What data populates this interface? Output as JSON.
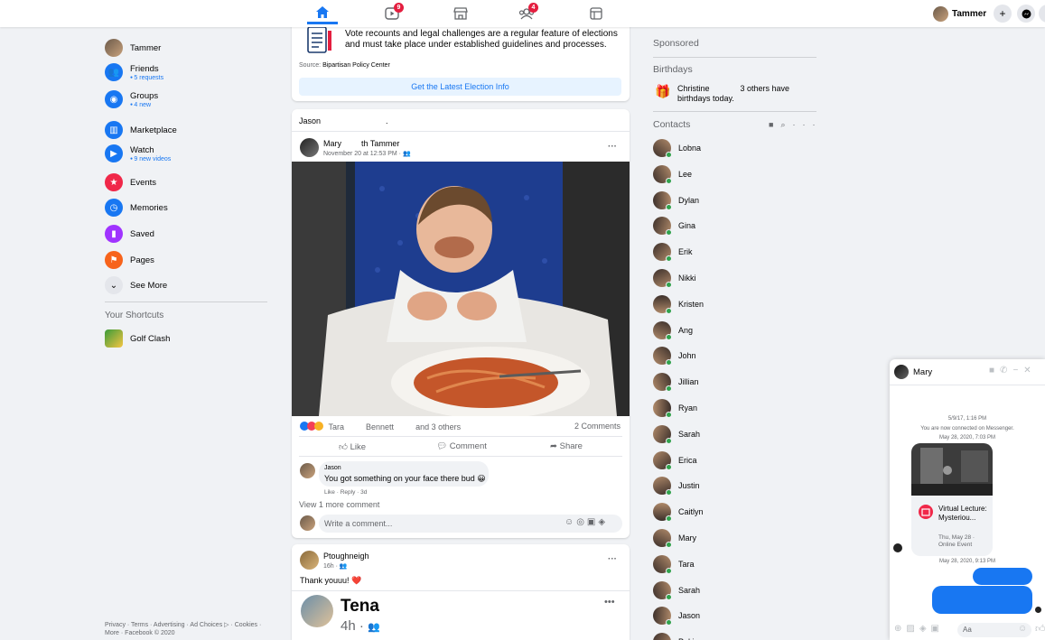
{
  "topbar": {
    "watch_badge": "9",
    "groups_badge": "4",
    "profile_name": "Tammer",
    "plus": "+",
    "icons": [
      "home-icon",
      "watch-icon",
      "marketplace-icon",
      "groups-icon",
      "gaming-icon"
    ]
  },
  "left_nav": {
    "profile": "Tammer",
    "items": [
      {
        "label": "Friends",
        "sub": "5 requests",
        "icon": "friends-icon",
        "color": "#1877f2"
      },
      {
        "label": "Groups",
        "sub": "4 new",
        "icon": "groups-icon",
        "color": "#1877f2"
      },
      {
        "label": "Marketplace",
        "sub": "",
        "icon": "marketplace-icon",
        "color": "#1877f2"
      },
      {
        "label": "Watch",
        "sub": "9 new videos",
        "icon": "watch-icon",
        "color": "#1877f2"
      },
      {
        "label": "Events",
        "sub": "",
        "icon": "events-icon",
        "color": "#f02849"
      },
      {
        "label": "Memories",
        "sub": "",
        "icon": "memories-icon",
        "color": "#1877f2"
      },
      {
        "label": "Saved",
        "sub": "",
        "icon": "saved-icon",
        "color": "#a033ff"
      },
      {
        "label": "Pages",
        "sub": "",
        "icon": "pages-icon",
        "color": "#f7631b"
      },
      {
        "label": "See More",
        "sub": "",
        "icon": "chevron-down-icon",
        "color": "#e4e6eb"
      }
    ],
    "shortcuts_title": "Your Shortcuts",
    "shortcut": "Golf Clash",
    "footer": "Privacy · Terms · Advertising · Ad Choices ▷ · Cookies · More · Facebook © 2020"
  },
  "election_card": {
    "text": "Vote recounts and legal challenges are a regular feature of elections and must take place under established guidelines and processes.",
    "source_prefix": "Source: ",
    "source": "Bipartisan Policy Center",
    "button": "Get the Latest Election Info"
  },
  "post": {
    "header_name": "Jason",
    "dot": ".",
    "author": "Mary",
    "with_text": "th Tammer",
    "time": "November 20 at 12:53 PM · ",
    "more": "···",
    "reactions_names": [
      "Tara",
      "Bennett",
      "and 3 others"
    ],
    "comments_count": "2 Comments",
    "actions": [
      "Like",
      "Comment",
      "Share"
    ],
    "comment_author": "Jason",
    "comment_text": "You got something on your face there bud 😀",
    "comment_meta": "Like · Reply · 3d",
    "view_more": "View 1 more comment",
    "write_placeholder": "Write a comment..."
  },
  "post2": {
    "author": "Ptoughneigh",
    "time": "16h · ",
    "more": "···",
    "text": "Thank youuu! ❤️",
    "shared_author": "Tena",
    "shared_time": "4h · ",
    "shared_more": "•••"
  },
  "right": {
    "sponsored": "Sponsored",
    "birthdays_title": "Birthdays",
    "birthday_name": "Christine",
    "birthday_others": "3 others",
    "birthday_have": " have",
    "birthday_tail": "birthdays today.",
    "contacts_title": "Contacts",
    "contacts": [
      "Lobna",
      "Lee",
      "Dylan",
      "Gina",
      "Erik",
      "Nikki",
      "Kristen",
      "Ang",
      "John",
      "Jillian",
      "Ryan",
      "Sarah",
      "Erica",
      "Justin",
      "Caitlyn",
      "Mary",
      "Tara",
      "Sarah",
      "Jason",
      "Pakinam"
    ]
  },
  "chat": {
    "name": "Mary",
    "ts1": "5/9/17, 1:16 PM",
    "connected": "You are now connected on Messenger.",
    "ts2": "May 28, 2020, 7:03 PM",
    "event_title": "Virtual Lecture: Mysteriou...",
    "event_date": "Thu, May 28 ·",
    "event_type": "Online Event",
    "ts3": "May 28, 2020, 9:13 PM",
    "input_placeholder": "Aa"
  }
}
